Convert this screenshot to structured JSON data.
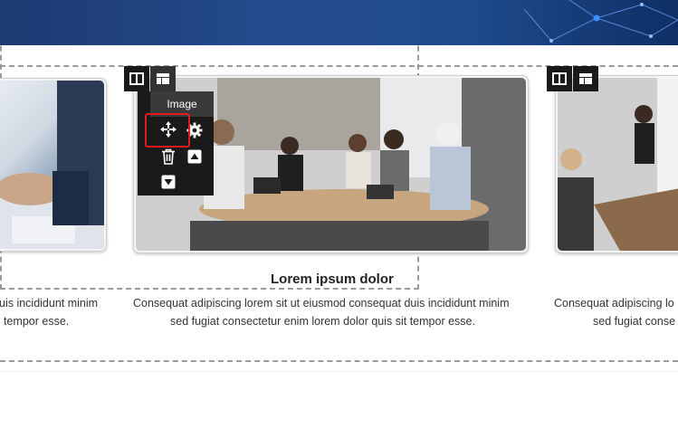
{
  "hero": {
    "description_icon": "network-graphic"
  },
  "cards": [
    {
      "title": "",
      "line1": "uis incididunt minim",
      "line2": "tempor esse."
    },
    {
      "title": "Lorem ipsum dolor",
      "line1": "Consequat adipiscing lorem sit ut eiusmod consequat duis incididunt minim",
      "line2": "sed fugiat consectetur enim lorem dolor quis sit tempor esse."
    },
    {
      "title": "",
      "line1": "Consequat adipiscing lo",
      "line2": "sed fugiat conse"
    }
  ],
  "toolbar": {
    "column_icon": "columns-icon",
    "layout_icon": "layout-icon",
    "menu_label": "Image",
    "menu_items": [
      "move-icon",
      "gear-icon",
      "trash-icon",
      "caret-up-icon",
      "caret-down-icon"
    ]
  },
  "colors": {
    "accent_highlight": "#e11b1b",
    "toolbar_bg": "#1a1a1a",
    "hero_bg": "#244d8e"
  }
}
